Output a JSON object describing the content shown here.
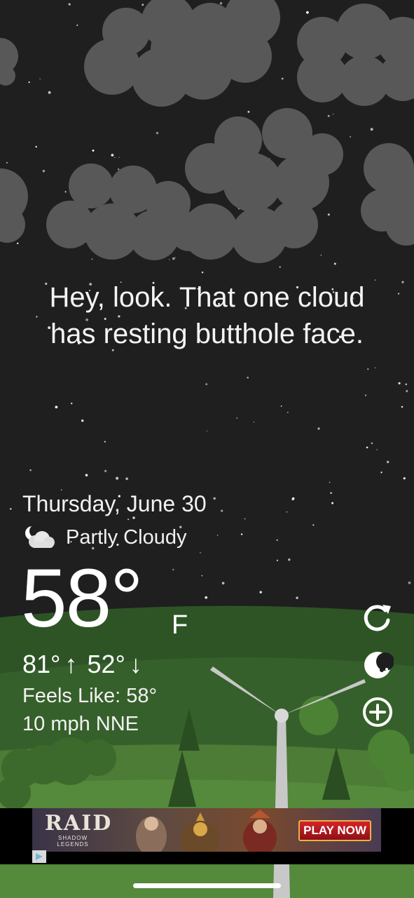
{
  "message": {
    "line1": "Hey, look. That one cloud",
    "line2": "has resting butthole face."
  },
  "weather": {
    "date": "Thursday, June 30",
    "condition": "Partly Cloudy",
    "condition_icon": "partly-cloudy-night-icon",
    "temperature": "58°",
    "unit": "F",
    "high": "81°",
    "high_arrow": "↑",
    "low": "52°",
    "low_arrow": "↓",
    "feels_like_label": "Feels Like:",
    "feels_like_value": "58°",
    "wind": "10 mph NNE"
  },
  "actions": {
    "refresh_icon": "refresh-icon",
    "moon_icon": "moon-phase-icon",
    "add_icon": "add-location-icon"
  },
  "ad": {
    "logo_main": "RAID",
    "logo_sub": "SHADOW LEGENDS",
    "cta": "PLAY NOW",
    "choices_icon": "ad-choices-icon"
  },
  "colors": {
    "sky": "#1e1e1e",
    "cloud": "#5a5a5a",
    "hill_dark": "#2f5a2a",
    "hill_light": "#4e7d36",
    "text": "#ffffff",
    "ad_cta": "#d4232a"
  }
}
